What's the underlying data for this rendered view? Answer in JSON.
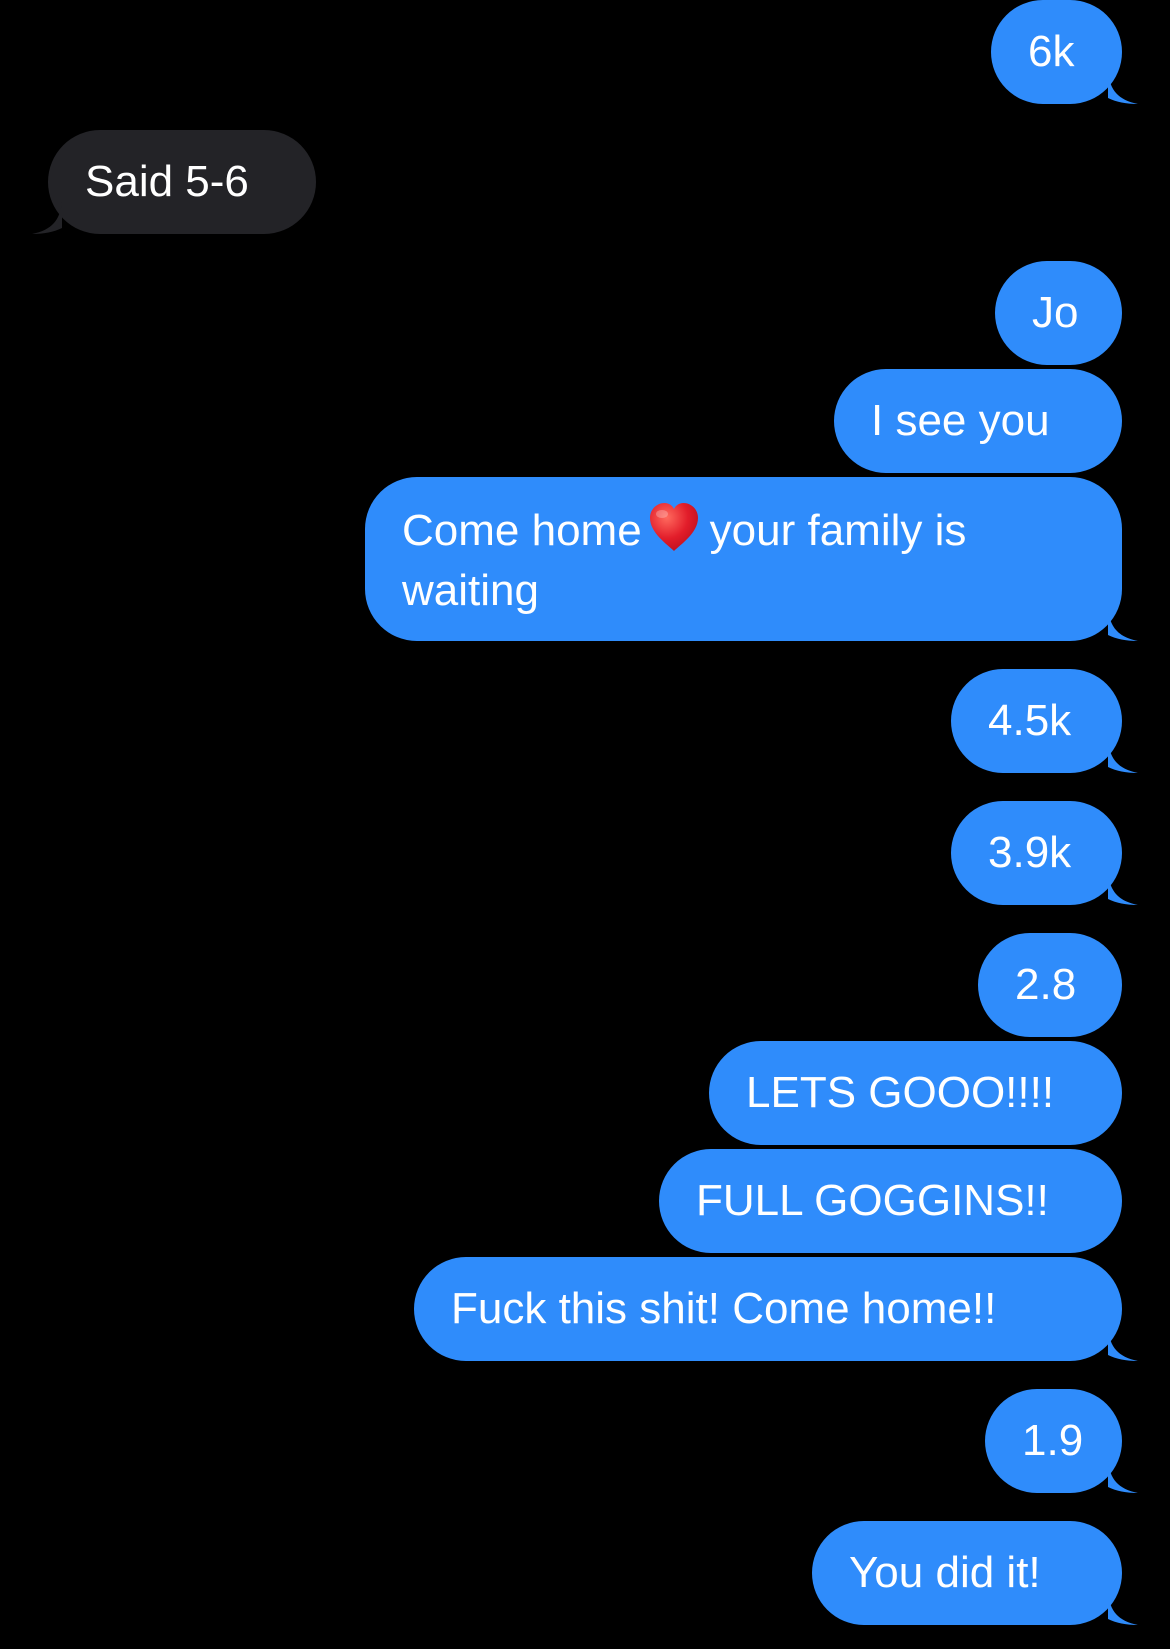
{
  "conversation": {
    "colors": {
      "background": "#000000",
      "sent_bubble": "#2f8cfb",
      "received_bubble": "#232327",
      "text": "#ffffff"
    },
    "messages": [
      {
        "direction": "sent",
        "text": "6k"
      },
      {
        "direction": "received",
        "text": "Said 5-6"
      },
      {
        "direction": "sent",
        "text": "Jo"
      },
      {
        "direction": "sent",
        "text": "I see you"
      },
      {
        "direction": "sent",
        "text_before": "Come home",
        "emoji": "heart-emoji",
        "text_after": "your family is waiting"
      },
      {
        "direction": "sent",
        "text": "4.5k"
      },
      {
        "direction": "sent",
        "text": "3.9k"
      },
      {
        "direction": "sent",
        "text": "2.8"
      },
      {
        "direction": "sent",
        "text": "LETS GOOO!!!!"
      },
      {
        "direction": "sent",
        "text": "FULL GOGGINS!!"
      },
      {
        "direction": "sent",
        "text": "Fuck this shit! Come home!!"
      },
      {
        "direction": "sent",
        "text": "1.9"
      },
      {
        "direction": "sent",
        "text": "You did it!"
      }
    ]
  }
}
